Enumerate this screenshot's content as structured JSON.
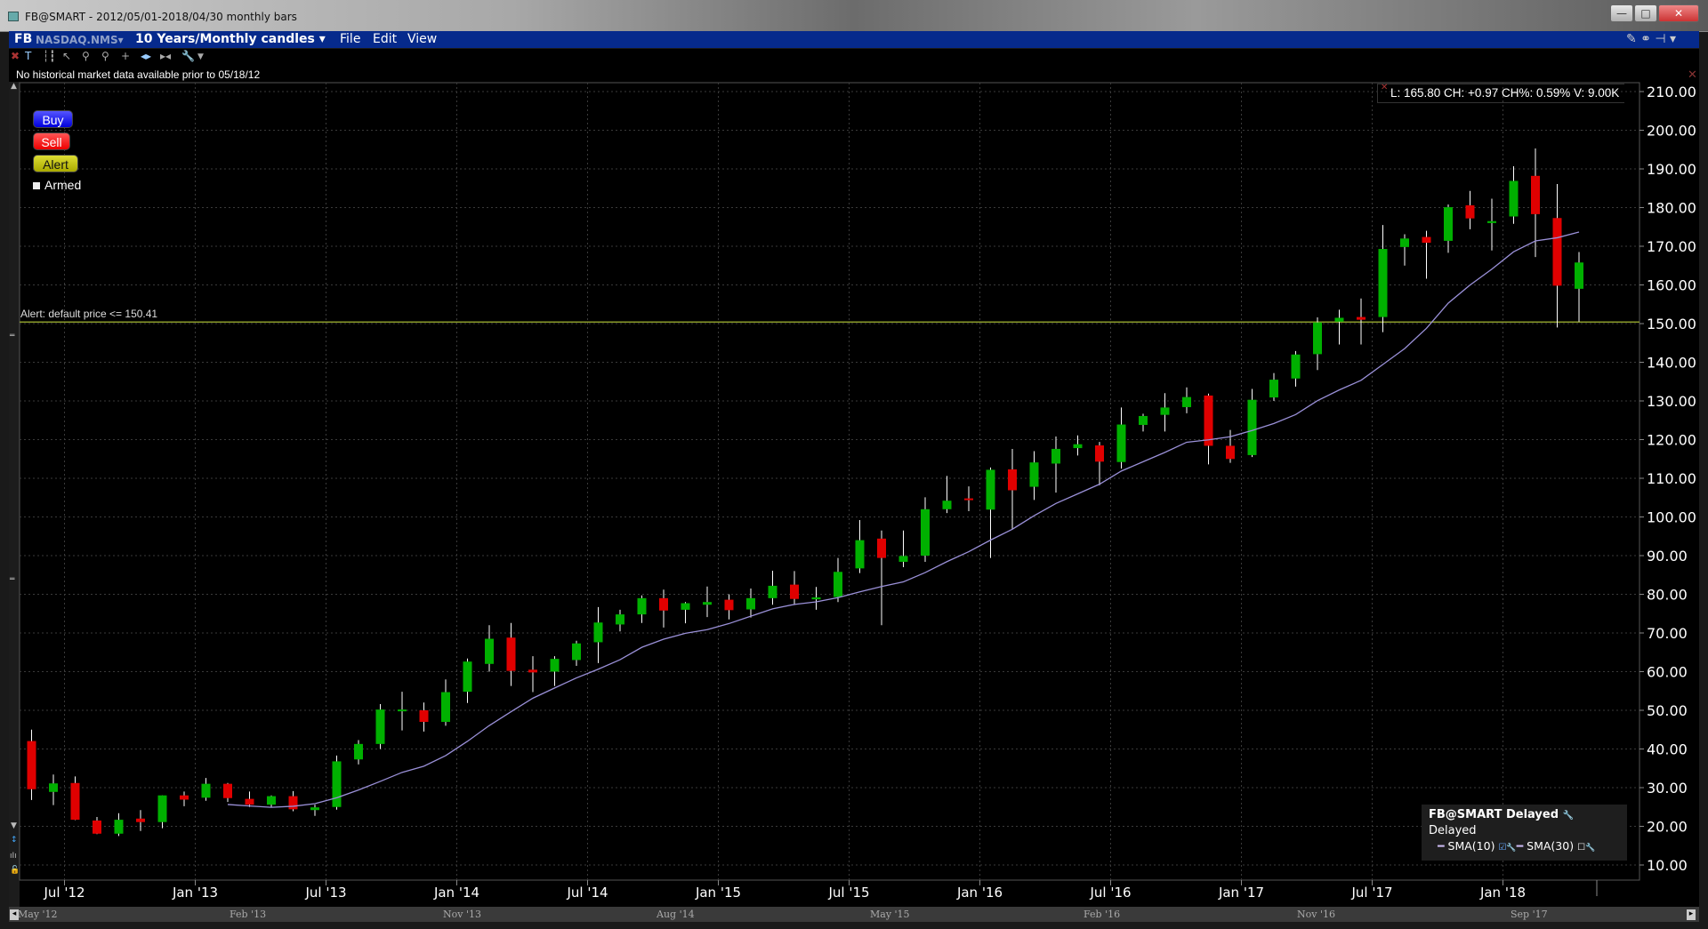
{
  "window": {
    "title": "FB@SMART - 2012/05/01-2018/04/30 monthly bars",
    "minimize": "—",
    "maximize": "□",
    "close": "✕"
  },
  "menubar": {
    "symbol": "FB",
    "exchange": "NASDAQ.NMS▾",
    "period": "10 Years/Monthly candles ▾",
    "file": "File",
    "edit": "Edit",
    "view": "View",
    "right_icons": "✎ ⚭ ⊣ ▾"
  },
  "toolbar": {
    "icons": [
      "close-icon",
      "text-icon",
      "bars-icon",
      "cursor-icon",
      "zoom-in-icon",
      "zoom-out-icon",
      "crosshair-icon",
      "expand-icon",
      "compress-icon",
      "wrench-icon",
      "dropdown-icon"
    ]
  },
  "note": "No historical market data available prior to 05/18/12",
  "order_buttons": {
    "buy": "Buy",
    "sell": "Sell",
    "alert": "Alert",
    "armed": "Armed"
  },
  "alert": {
    "label": "Alert: default price <= 150.41",
    "price": 150.41,
    "color": "#8a9a2a"
  },
  "info": "L: 165.80 CH: +0.97 CH%: 0.59% V: 9.00K",
  "legend": {
    "title": "FB@SMART Delayed",
    "status": "Delayed",
    "sma10": "SMA(10)",
    "sma30": "SMA(30)"
  },
  "colors": {
    "up": "#00b000",
    "down": "#e00000",
    "sma": "#9a90d8"
  },
  "chart_data": {
    "type": "candlestick",
    "start_month": "2012-05",
    "ylim": [
      10,
      210
    ],
    "yticks": [
      "10.00",
      "20.00",
      "30.00",
      "40.00",
      "50.00",
      "60.00",
      "70.00",
      "80.00",
      "90.00",
      "100.00",
      "110.00",
      "120.00",
      "130.00",
      "140.00",
      "150.00",
      "160.00",
      "170.00",
      "180.00",
      "190.00",
      "200.00",
      "210.00"
    ],
    "xticks": [
      {
        "label": "Jul '12",
        "i": 2
      },
      {
        "label": "Jan '13",
        "i": 8
      },
      {
        "label": "Jul '13",
        "i": 14
      },
      {
        "label": "Jan '14",
        "i": 20
      },
      {
        "label": "Jul '14",
        "i": 26
      },
      {
        "label": "Jan '15",
        "i": 32
      },
      {
        "label": "Jul '15",
        "i": 38
      },
      {
        "label": "Jan '16",
        "i": 44
      },
      {
        "label": "Jul '16",
        "i": 50
      },
      {
        "label": "Jan '17",
        "i": 56
      },
      {
        "label": "Jul '17",
        "i": 62
      },
      {
        "label": "Jan '18",
        "i": 68
      }
    ],
    "sma_period": 10,
    "ohlc": [
      [
        42.05,
        45,
        26.8,
        29.6
      ],
      [
        28.9,
        33.4,
        25.5,
        31.1
      ],
      [
        31.2,
        32.9,
        21.6,
        21.7
      ],
      [
        21.5,
        22.4,
        18,
        18.1
      ],
      [
        18.1,
        23.4,
        17.5,
        21.7
      ],
      [
        22,
        24.2,
        18.8,
        21.1
      ],
      [
        21.1,
        28,
        19.5,
        28
      ],
      [
        28,
        29,
        25.2,
        26.9
      ],
      [
        27.4,
        32.5,
        26.6,
        31
      ],
      [
        31,
        31.2,
        26.3,
        27.3
      ],
      [
        27.1,
        29,
        25,
        25.6
      ],
      [
        25.6,
        28,
        25,
        27.8
      ],
      [
        27.8,
        29.1,
        23.9,
        24.4
      ],
      [
        24.2,
        25.6,
        22.7,
        24.9
      ],
      [
        25,
        38.3,
        24.3,
        36.8
      ],
      [
        37.3,
        42.3,
        36,
        41.3
      ],
      [
        41.3,
        51.6,
        40,
        50.2
      ],
      [
        50,
        54.8,
        44.8,
        50.2
      ],
      [
        50,
        52,
        44.5,
        47
      ],
      [
        47,
        58,
        46,
        54.7
      ],
      [
        54.8,
        63.4,
        51.9,
        62.6
      ],
      [
        62,
        72,
        60,
        68.5
      ],
      [
        68.8,
        72.6,
        56.3,
        60.2
      ],
      [
        60.5,
        64,
        54.7,
        59.8
      ],
      [
        60,
        64,
        56.3,
        63.3
      ],
      [
        63,
        68,
        61.5,
        67.3
      ],
      [
        67.6,
        76.7,
        62.2,
        72.7
      ],
      [
        72.2,
        76,
        70.4,
        74.8
      ],
      [
        74.8,
        79.7,
        72.6,
        79
      ],
      [
        79,
        81.2,
        71.4,
        75.8
      ],
      [
        76,
        78,
        72.5,
        77.7
      ],
      [
        77.3,
        82,
        74.1,
        78
      ],
      [
        78.6,
        80,
        73.5,
        75.9
      ],
      [
        76.1,
        81.5,
        74,
        79
      ],
      [
        79,
        86.1,
        77.3,
        82.2
      ],
      [
        82.5,
        86,
        77.2,
        78.8
      ],
      [
        78.7,
        81.9,
        76,
        79.2
      ],
      [
        79.3,
        89.4,
        78,
        85.8
      ],
      [
        86.7,
        99.2,
        85.5,
        94
      ],
      [
        94.4,
        96.5,
        72,
        89.4
      ],
      [
        88.4,
        96.5,
        87,
        89.9
      ],
      [
        90,
        105.1,
        88.4,
        102
      ],
      [
        102,
        110.6,
        101,
        104.2
      ],
      [
        104.8,
        107.9,
        101.5,
        104.7
      ],
      [
        101.9,
        112.8,
        89.4,
        112.2
      ],
      [
        112.3,
        117.6,
        96.8,
        106.9
      ],
      [
        107.8,
        117,
        104.4,
        114.1
      ],
      [
        113.8,
        120.8,
        106.3,
        117.6
      ],
      [
        117.8,
        121.1,
        115.9,
        118.8
      ],
      [
        118.5,
        119.4,
        108.2,
        114.3
      ],
      [
        114.2,
        128.3,
        112.5,
        123.9
      ],
      [
        123.8,
        126.7,
        122.1,
        126.1
      ],
      [
        126.4,
        132,
        122.1,
        128.3
      ],
      [
        128.4,
        133.5,
        126.8,
        131
      ],
      [
        131.4,
        131.9,
        113.6,
        118.4
      ],
      [
        118.4,
        122.5,
        114,
        115
      ],
      [
        116,
        133.1,
        115.5,
        130.3
      ],
      [
        130.9,
        137.2,
        130,
        135.5
      ],
      [
        135.8,
        142.9,
        133.7,
        142
      ],
      [
        142.1,
        151.6,
        138,
        150.3
      ],
      [
        150.5,
        153.6,
        144.6,
        151.5
      ],
      [
        151.7,
        156.5,
        144.6,
        151
      ],
      [
        151.7,
        175.5,
        147.8,
        169.3
      ],
      [
        169.8,
        173.1,
        165,
        172
      ],
      [
        172.4,
        174,
        161.6,
        170.9
      ],
      [
        171.4,
        180.8,
        168.3,
        180.1
      ],
      [
        180.6,
        184.3,
        174.4,
        177.2
      ],
      [
        176,
        182.3,
        168.9,
        176.5
      ],
      [
        177.7,
        190.7,
        175.8,
        186.9
      ],
      [
        188.2,
        195.3,
        167.2,
        178.3
      ],
      [
        177.3,
        186.1,
        149,
        159.8
      ],
      [
        159,
        168.5,
        150.5,
        165.8
      ]
    ]
  },
  "scrollbar": {
    "labels": [
      "May '12",
      "Feb '13",
      "Nov '13",
      "Aug '14",
      "May '15",
      "Feb '16",
      "Nov '16",
      "Sep '17"
    ]
  }
}
